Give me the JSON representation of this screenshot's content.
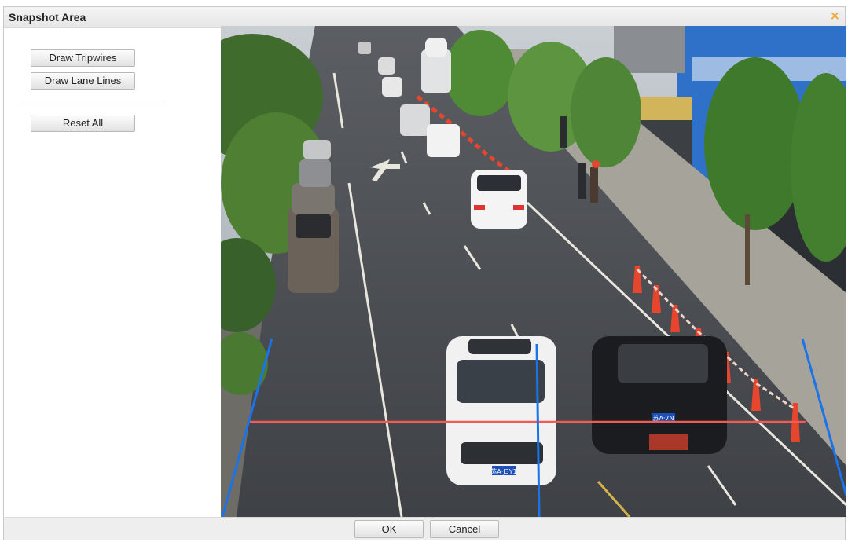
{
  "dialog": {
    "title": "Snapshot Area",
    "close_icon": "close-icon"
  },
  "left_panel": {
    "draw_tripwires": "Draw Tripwires",
    "draw_lane_lines": "Draw Lane Lines",
    "reset_all": "Reset All"
  },
  "footer": {
    "ok": "OK",
    "cancel": "Cancel"
  },
  "overlay_colors": {
    "tripwire": "#f25a52",
    "lane_line": "#1a73e8"
  },
  "snapshot": {
    "plate_white_car": "苏A·J3Y1",
    "plate_black_car": "苏A·7N"
  }
}
